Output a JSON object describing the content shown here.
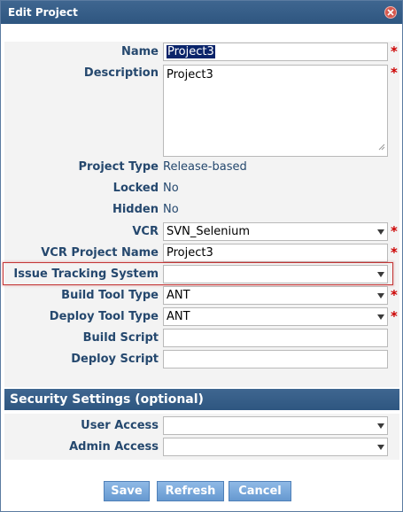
{
  "dialog": {
    "title": "Edit Project"
  },
  "form": {
    "name": {
      "label": "Name",
      "value": "Project3",
      "required": "*"
    },
    "description": {
      "label": "Description",
      "value": "Project3",
      "required": "*"
    },
    "project_type": {
      "label": "Project Type",
      "value": "Release-based"
    },
    "locked": {
      "label": "Locked",
      "value": "No"
    },
    "hidden": {
      "label": "Hidden",
      "value": "No"
    },
    "vcr": {
      "label": "VCR",
      "value": "SVN_Selenium",
      "required": "*"
    },
    "vcr_project_name": {
      "label": "VCR Project Name",
      "value": "Project3",
      "required": "*"
    },
    "issue_tracking_system": {
      "label": "Issue Tracking System",
      "value": ""
    },
    "build_tool_type": {
      "label": "Build Tool Type",
      "value": "ANT",
      "required": "*"
    },
    "deploy_tool_type": {
      "label": "Deploy Tool Type",
      "value": "ANT",
      "required": "*"
    },
    "build_script": {
      "label": "Build Script",
      "value": ""
    },
    "deploy_script": {
      "label": "Deploy Script",
      "value": ""
    }
  },
  "security": {
    "title": "Security Settings (optional)",
    "user_access": {
      "label": "User Access",
      "value": ""
    },
    "admin_access": {
      "label": "Admin Access",
      "value": ""
    }
  },
  "buttons": {
    "save": "Save",
    "refresh": "Refresh",
    "cancel": "Cancel"
  },
  "colors": {
    "header": "#2e5680",
    "label": "#25486e",
    "required": "#cc0000",
    "button": "#7aa8dc",
    "focus_border": "#c43535"
  },
  "icons": {
    "close": "close-icon",
    "dropdown": "chevron-down-icon",
    "resize": "resize-grip-icon"
  }
}
